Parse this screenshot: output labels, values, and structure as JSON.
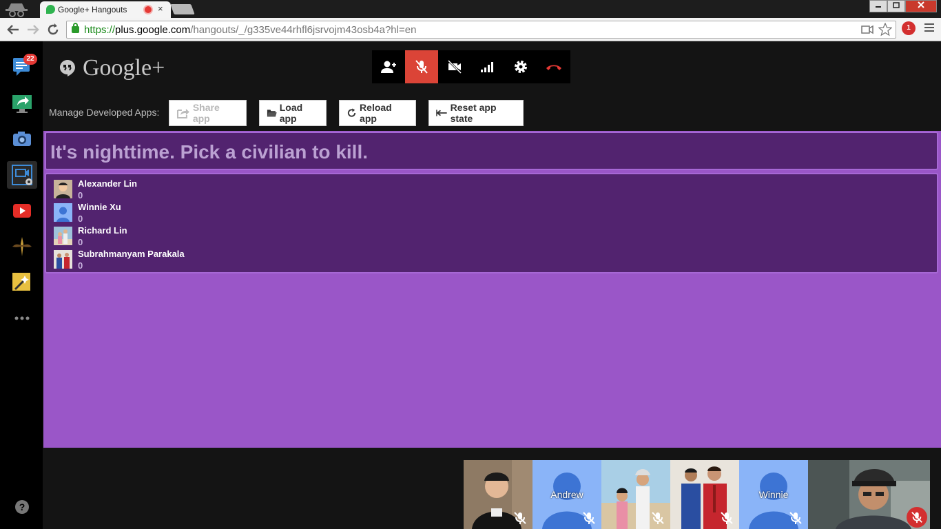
{
  "browser": {
    "tab_title": "Google+ Hangouts",
    "tab_close": "×",
    "url_protocol": "https://",
    "url_host": "plus.google.com",
    "url_path": "/hangouts/_/g335ve44rhfl6jsrvojm43osb4a?hl=en",
    "extension_badge": "1"
  },
  "sidebar": {
    "items": [
      {
        "icon": "chat-icon",
        "badge": "22"
      },
      {
        "icon": "screenshare-icon"
      },
      {
        "icon": "camera-icon"
      },
      {
        "icon": "app-dev-icon",
        "active": true
      },
      {
        "icon": "youtube-icon"
      },
      {
        "icon": "mustache-icon"
      },
      {
        "icon": "magic-effects-icon"
      },
      {
        "icon": "more-icon"
      },
      {
        "icon": "help-icon"
      }
    ]
  },
  "header": {
    "logo_text": "Google+"
  },
  "controls": [
    {
      "icon": "invite-people-icon"
    },
    {
      "icon": "microphone-muted-icon",
      "active": true
    },
    {
      "icon": "camera-off-icon"
    },
    {
      "icon": "bandwidth-icon"
    },
    {
      "icon": "settings-icon"
    },
    {
      "icon": "hang-up-icon"
    }
  ],
  "dev_apps": {
    "label": "Manage Developed Apps:",
    "share_label": "Share app",
    "load_label": "Load app",
    "reload_label": "Reload app",
    "reset_label": "Reset app state"
  },
  "game": {
    "heading": "It's nighttime. Pick a civilian to kill.",
    "players": [
      {
        "name": "Alexander Lin",
        "votes": "0"
      },
      {
        "name": "Winnie Xu",
        "votes": "0"
      },
      {
        "name": "Richard Lin",
        "votes": "0"
      },
      {
        "name": "Subrahmanyam Parakala",
        "votes": "0"
      }
    ]
  },
  "filmstrip": [
    {
      "label": ""
    },
    {
      "label": "Andrew"
    },
    {
      "label": ""
    },
    {
      "label": ""
    },
    {
      "label": "Winnie"
    },
    {
      "label": ""
    }
  ],
  "colors": {
    "accent_red": "#db4437",
    "stage_purple": "#9a56c8",
    "panel_purple": "#52236f"
  }
}
